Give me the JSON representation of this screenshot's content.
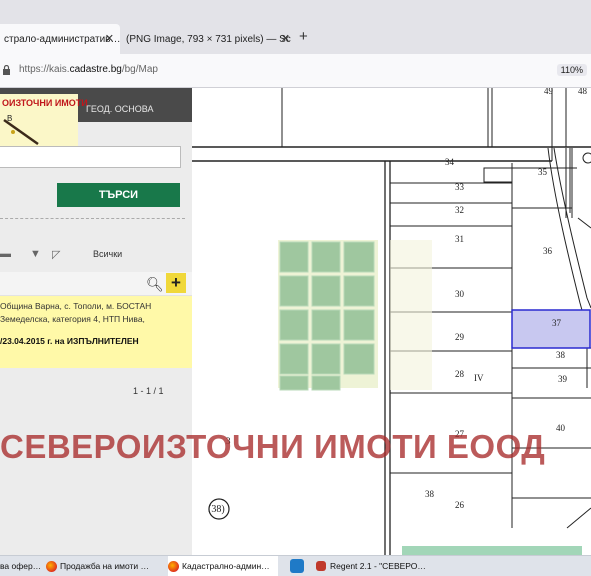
{
  "browser": {
    "tabs": [
      {
        "title": "страло-административ…",
        "close": "✕"
      },
      {
        "title": "(PNG Image, 793 × 731 pixels) — Sc",
        "close": "✕"
      }
    ],
    "new_tab": "+",
    "url_base": "https://kais.",
    "url_domain": "cadastre.bg",
    "url_path": "/bg/Map",
    "zoom": "110%"
  },
  "panel": {
    "logo_text": "ОИЗТОЧНИ ИМОТИ",
    "tab_label": "ГЕОД. ОСНОВА",
    "search_button": "ТЪРСИ",
    "filter_all": "Всички",
    "result_lines": [
      "Община Варна, с. Тополи, м. БОСТАН",
      "Земеделска, категория 4, НТП Нива,",
      "/23.04.2015 г. на ИЗПЪЛНИТЕЛЕН"
    ],
    "pager": "1 - 1 / 1"
  },
  "map": {
    "labels": [
      "49",
      "48",
      "34",
      "35",
      "33",
      "32",
      "31",
      "36",
      "30",
      "37",
      "29",
      "38",
      "28",
      "IV",
      "39",
      "40",
      "27",
      "26",
      "38",
      "3",
      "(38)"
    ],
    "highlight_parcel": "37",
    "highlight_color": "#c8c8f0",
    "orchard_color": "#9fc79f"
  },
  "watermark": "СЕВЕРОИЗТОЧНИ ИМОТИ ЕООД",
  "taskbar": [
    {
      "label": "ва офер…"
    },
    {
      "label": "Продажба на имоти …"
    },
    {
      "label": "Кадастрално-админ…"
    },
    {
      "label": "Regent 2.1 - \"СЕВЕРО…"
    }
  ]
}
